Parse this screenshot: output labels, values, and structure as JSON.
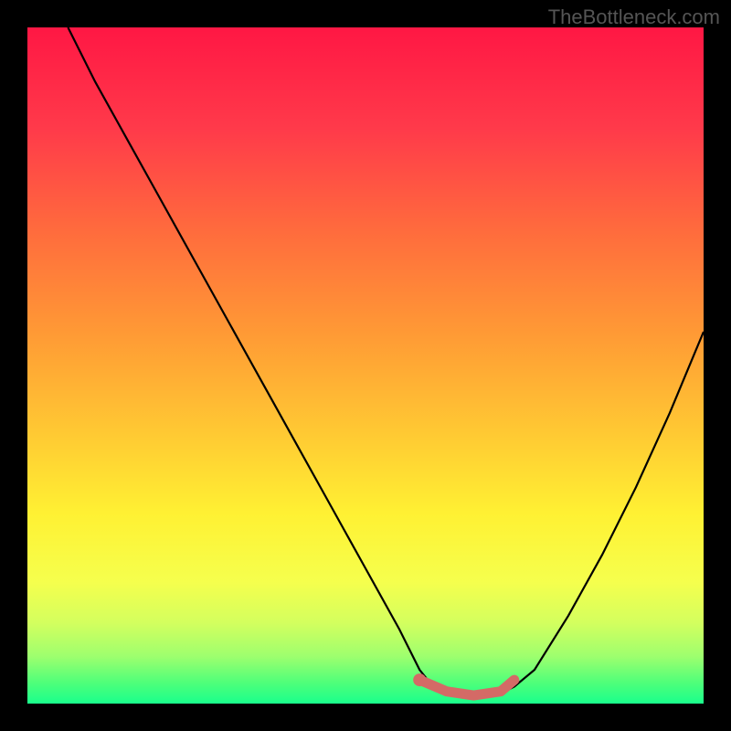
{
  "attribution": "TheBottleneck.com",
  "chart_data": {
    "type": "line",
    "title": "",
    "xlabel": "",
    "ylabel": "",
    "xlim": [
      0,
      100
    ],
    "ylim": [
      0,
      100
    ],
    "series": [
      {
        "name": "bottleneck-curve",
        "x": [
          6,
          10,
          15,
          20,
          25,
          30,
          35,
          40,
          45,
          50,
          55,
          58,
          60,
          62,
          64,
          66,
          68,
          70,
          72,
          75,
          80,
          85,
          90,
          95,
          100
        ],
        "y": [
          100,
          92,
          83,
          74,
          65,
          56,
          47,
          38,
          29,
          20,
          11,
          5,
          2.5,
          1.5,
          1,
          1,
          1,
          1.5,
          2.5,
          5,
          13,
          22,
          32,
          43,
          55
        ]
      }
    ],
    "highlight": {
      "name": "sweet-spot",
      "x": [
        58,
        62,
        66,
        70,
        72
      ],
      "y": [
        3.5,
        1.8,
        1.2,
        1.8,
        3.5
      ]
    },
    "gradient_stops": [
      {
        "offset": 0,
        "color": "#ff1744"
      },
      {
        "offset": 15,
        "color": "#ff3a4a"
      },
      {
        "offset": 30,
        "color": "#ff6b3d"
      },
      {
        "offset": 45,
        "color": "#ff9935"
      },
      {
        "offset": 60,
        "color": "#ffc933"
      },
      {
        "offset": 72,
        "color": "#fff133"
      },
      {
        "offset": 82,
        "color": "#f5ff4d"
      },
      {
        "offset": 88,
        "color": "#d4ff5e"
      },
      {
        "offset": 93,
        "color": "#9eff6e"
      },
      {
        "offset": 97,
        "color": "#4dff7a"
      },
      {
        "offset": 100,
        "color": "#1aff8c"
      }
    ]
  }
}
